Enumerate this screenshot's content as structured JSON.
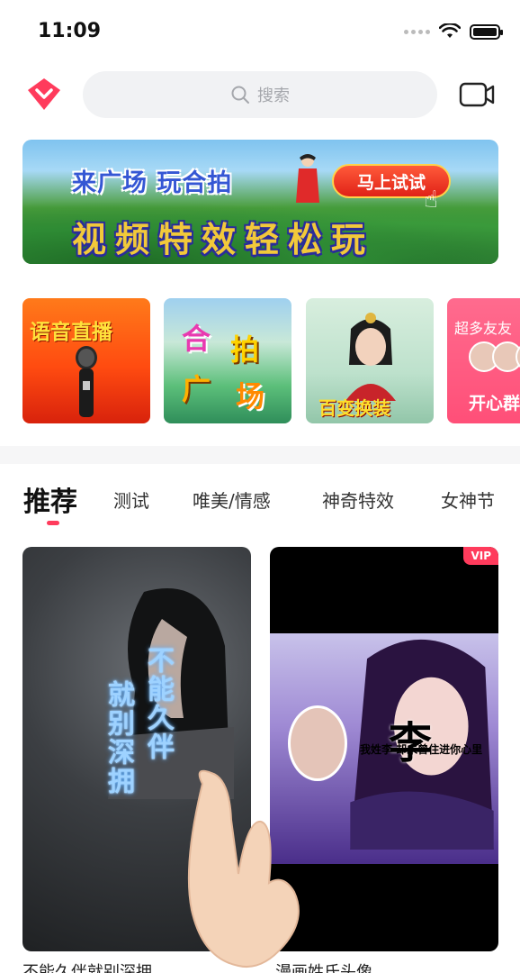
{
  "status_bar": {
    "time": "11:09"
  },
  "search": {
    "placeholder": "搜索"
  },
  "banner": {
    "line1": "来广场 玩合拍",
    "line2": "视频特效轻松玩",
    "button": "马上试试"
  },
  "categories": [
    {
      "label": "语音直播"
    },
    {
      "label_parts": [
        "合",
        "拍",
        "广",
        "场"
      ]
    },
    {
      "label": "百变换装"
    },
    {
      "top": "超多友友",
      "bottom": "开心群"
    }
  ],
  "tabs": [
    {
      "label": "推荐",
      "active": true
    },
    {
      "label": "测试",
      "active": false
    },
    {
      "label": "唯美/情感",
      "active": false
    },
    {
      "label": "神奇特效",
      "active": false
    },
    {
      "label": "女神节",
      "active": false
    }
  ],
  "feed": [
    {
      "title": "不能久伴就别深拥",
      "overlay_lines": [
        "不能久伴",
        "就别深拥"
      ]
    },
    {
      "title": "漫画姓氏头像",
      "badge": "VIP",
      "big_char": "李",
      "caption": "我姓李 却未曾住进你心里"
    }
  ],
  "colors": {
    "accent": "#ff3b5c",
    "search_bg": "#f1f2f4",
    "divider": "#f6f6f7"
  },
  "icons": [
    "logo-icon",
    "search-icon",
    "camera-icon",
    "wifi-icon",
    "battery-icon",
    "microphone-icon",
    "hand-cursor-icon"
  ]
}
